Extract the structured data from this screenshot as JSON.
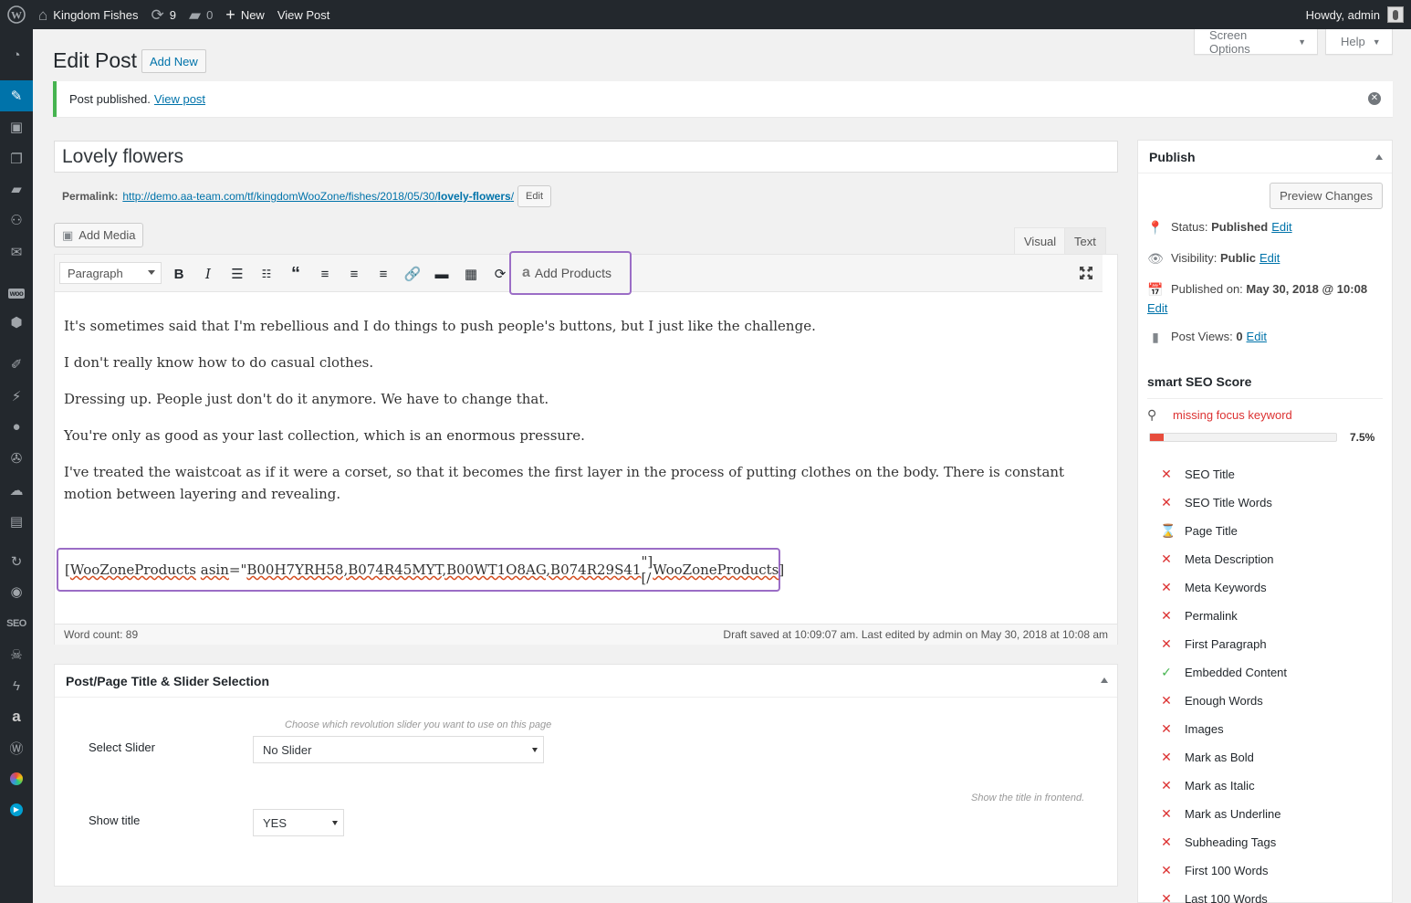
{
  "adminbar": {
    "site_name": "Kingdom Fishes",
    "updates_count": "9",
    "comments_count": "0",
    "new_label": "New",
    "view_post_label": "View Post",
    "howdy": "Howdy, admin"
  },
  "menu_icons": [
    "dashboard-icon",
    "posts-icon",
    "media-icon",
    "pages-icon",
    "comments-icon",
    "fish-icon",
    "mail-icon",
    "woo-icon",
    "products-icon",
    "appearance-icon",
    "plugins-icon",
    "users-icon",
    "tools-icon",
    "settings-icon",
    "layout-icon",
    "revolution-icon",
    "seo-icon",
    "seo-text",
    "pirate-icon",
    "lightning-icon",
    "amazon-icon",
    "wordpress-icon",
    "color-icon",
    "play-icon"
  ],
  "screen_options": "Screen Options",
  "help": "Help",
  "page_title": "Edit Post",
  "add_new": "Add New",
  "notice": {
    "text": "Post published.",
    "link": "View post"
  },
  "post_title": "Lovely flowers",
  "permalink": {
    "label": "Permalink:",
    "url_prefix": "http://demo.aa-team.com/tf/kingdomWooZone/fishes/2018/05/30/",
    "slug": "lovely-flowers",
    "url_suffix": "/",
    "edit": "Edit"
  },
  "add_media": "Add Media",
  "tabs": {
    "visual": "Visual",
    "text": "Text"
  },
  "toolbar": {
    "format": "Paragraph",
    "add_products": "Add Products"
  },
  "content": {
    "paragraphs": [
      "It's sometimes said that I'm rebellious and I do things to push people's buttons, but I just like the challenge.",
      "I don't really know how to do casual clothes.",
      "Dressing up. People just don't do it anymore. We have to change that.",
      "You're only as good as your last collection, which is an enormous pressure.",
      "I've treated the waistcoat as if it were a corset, so that it becomes the first layer in the process of putting clothes on the body. There is constant motion between layering and revealing."
    ],
    "shortcode_open": "[",
    "shortcode_tag": "WooZoneProducts",
    "shortcode_attr": "asin",
    "shortcode_mid": "=\"",
    "shortcode_value": "B00H7YRH58,B074R45MYT,B00WT1O8AG,B074R29S41",
    "shortcode_close1": "\"][/",
    "shortcode_close2": "]"
  },
  "status": {
    "word_count": "Word count: 89",
    "draft_saved": "Draft saved at 10:09:07 am. Last edited by admin on May 30, 2018 at 10:08 am"
  },
  "slider_box": {
    "title": "Post/Page Title & Slider Selection",
    "hint1": "Choose which revolution slider you want to use on this page",
    "select_label": "Select Slider",
    "select_value": "No Slider",
    "hint2": "Show the title in frontend.",
    "show_label": "Show title",
    "show_value": "YES"
  },
  "publish": {
    "title": "Publish",
    "preview": "Preview Changes",
    "status_label": "Status:",
    "status_value": "Published",
    "visibility_label": "Visibility:",
    "visibility_value": "Public",
    "published_label": "Published on:",
    "published_value": "May 30, 2018 @ 10:08",
    "views_label": "Post Views:",
    "views_value": "0",
    "edit": "Edit"
  },
  "seo": {
    "title": "smart SEO Score",
    "missing": "missing focus keyword",
    "score": "7.5%",
    "score_value": 0.075,
    "checks": [
      {
        "label": "SEO Title",
        "state": "fail"
      },
      {
        "label": "SEO Title Words",
        "state": "fail"
      },
      {
        "label": "Page Title",
        "state": "pending"
      },
      {
        "label": "Meta Description",
        "state": "fail"
      },
      {
        "label": "Meta Keywords",
        "state": "fail"
      },
      {
        "label": "Permalink",
        "state": "fail"
      },
      {
        "label": "First Paragraph",
        "state": "fail"
      },
      {
        "label": "Embedded Content",
        "state": "pass"
      },
      {
        "label": "Enough Words",
        "state": "fail"
      },
      {
        "label": "Images",
        "state": "fail"
      },
      {
        "label": "Mark as Bold",
        "state": "fail"
      },
      {
        "label": "Mark as Italic",
        "state": "fail"
      },
      {
        "label": "Mark as Underline",
        "state": "fail"
      },
      {
        "label": "Subheading Tags",
        "state": "fail"
      },
      {
        "label": "First 100 Words",
        "state": "fail"
      },
      {
        "label": "Last 100 Words",
        "state": "fail"
      }
    ]
  },
  "colors": {
    "accent": "#0073aa",
    "success": "#46b450",
    "error": "#dc3232",
    "highlight": "#9b6dc6"
  }
}
